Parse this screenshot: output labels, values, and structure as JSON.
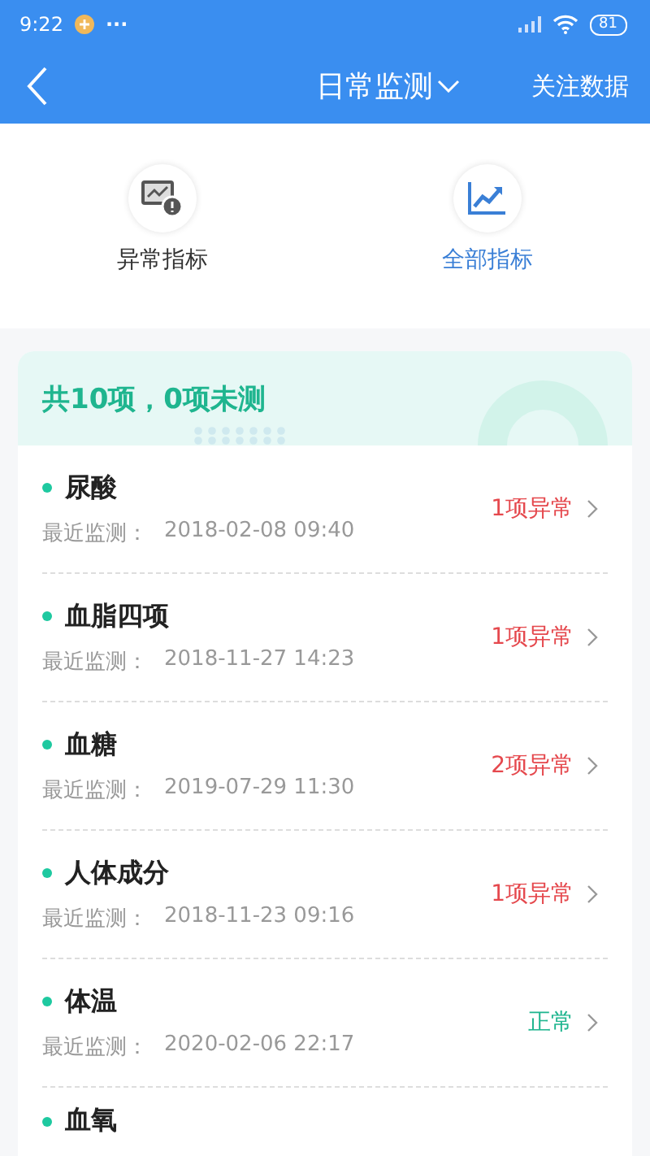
{
  "status_bar": {
    "time": "9:22",
    "dots": "···",
    "battery": "81"
  },
  "nav": {
    "title": "日常监测",
    "action": "关注数据"
  },
  "shortcuts": [
    {
      "label": "异常指标",
      "kind": "alert",
      "selected": false
    },
    {
      "label": "全部指标",
      "kind": "trend",
      "selected": true
    }
  ],
  "summary": "共10项，0项未测",
  "items": [
    {
      "name": "尿酸",
      "label": "最近监测：",
      "date": "2018-02-08 09:40",
      "status": "1项异常",
      "kind": "abnormal"
    },
    {
      "name": "血脂四项",
      "label": "最近监测：",
      "date": "2018-11-27 14:23",
      "status": "1项异常",
      "kind": "abnormal"
    },
    {
      "name": "血糖",
      "label": "最近监测：",
      "date": "2019-07-29 11:30",
      "status": "2项异常",
      "kind": "abnormal"
    },
    {
      "name": "人体成分",
      "label": "最近监测：",
      "date": "2018-11-23 09:16",
      "status": "1项异常",
      "kind": "abnormal"
    },
    {
      "name": "体温",
      "label": "最近监测：",
      "date": "2020-02-06 22:17",
      "status": "正常",
      "kind": "normal"
    },
    {
      "name": "血氧",
      "kind": "partial"
    }
  ]
}
